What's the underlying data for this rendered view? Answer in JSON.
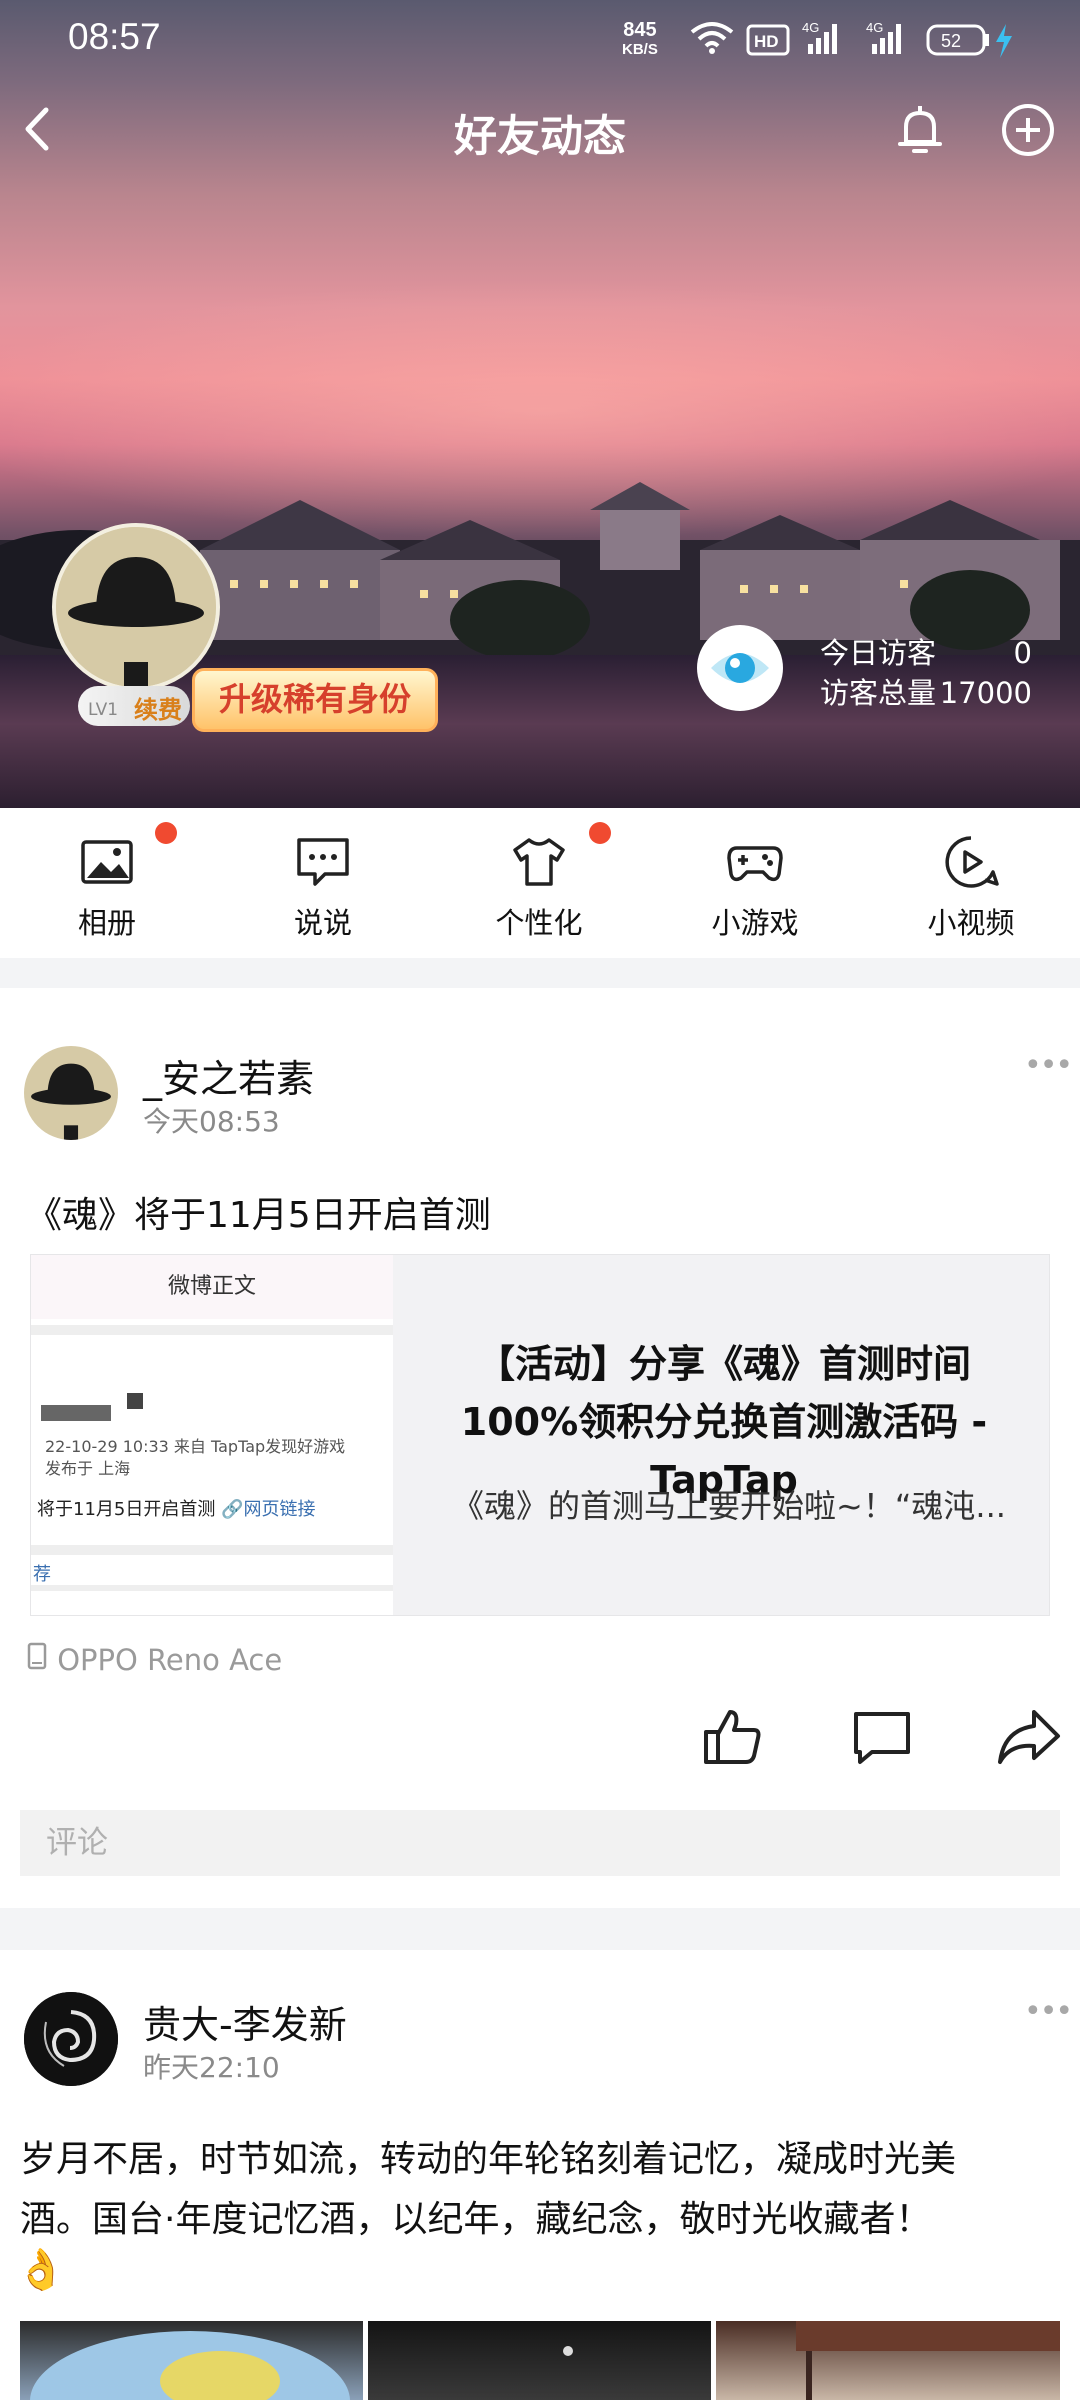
{
  "status_bar": {
    "time": "08:57",
    "net_speed_value": "845",
    "net_speed_unit": "KB/S",
    "hd_label": "HD",
    "sim1": "4G",
    "sim2": "4G",
    "battery": "52"
  },
  "nav": {
    "title": "好友动态"
  },
  "profile": {
    "level": "LV1",
    "renew": "续费",
    "upgrade_label": "升级稀有身份",
    "visitors_today_label": "今日访客",
    "visitors_today_value": "0",
    "visitors_total_label": "访客总量",
    "visitors_total_value": "17000"
  },
  "menu": {
    "items": [
      {
        "label": "相册",
        "icon": "photo-album-icon",
        "has_dot": true
      },
      {
        "label": "说说",
        "icon": "message-icon",
        "has_dot": false
      },
      {
        "label": "个性化",
        "icon": "tshirt-icon",
        "has_dot": true
      },
      {
        "label": "小游戏",
        "icon": "gamepad-icon",
        "has_dot": false
      },
      {
        "label": "小视频",
        "icon": "video-play-icon",
        "has_dot": false
      }
    ]
  },
  "posts": [
    {
      "author": "_安之若素",
      "time": "今天08:53",
      "text": "《魂》将于11月5日开启首测",
      "card": {
        "thumb_header": "微博正文",
        "thumb_date": "22-10-29 10:33  来自 TapTap发现好游戏",
        "thumb_location": "发布于 上海",
        "thumb_line": "将于11月5日开启首测",
        "thumb_link": "网页链接",
        "thumb_tag": "荐",
        "title": "【活动】分享《魂》首测时间 100%领积分兑换首测激活码 - TapTap",
        "desc": "《魂》的首测马上要开始啦~！“魂沌..."
      },
      "device": "OPPO Reno Ace",
      "comment_placeholder": "评论"
    },
    {
      "author": "贵大-李发新",
      "time": "昨天22:10",
      "text_line1": "岁月不居，时节如流，转动的年轮铭刻着记忆，凝成时光美",
      "text_line2": "酒。国台·年度记忆酒，以纪年，藏纪念，敬时光收藏者！",
      "emoji": "👌"
    }
  ],
  "colors": {
    "accent_red": "#f04a30",
    "eye_blue": "#29a8e0"
  }
}
